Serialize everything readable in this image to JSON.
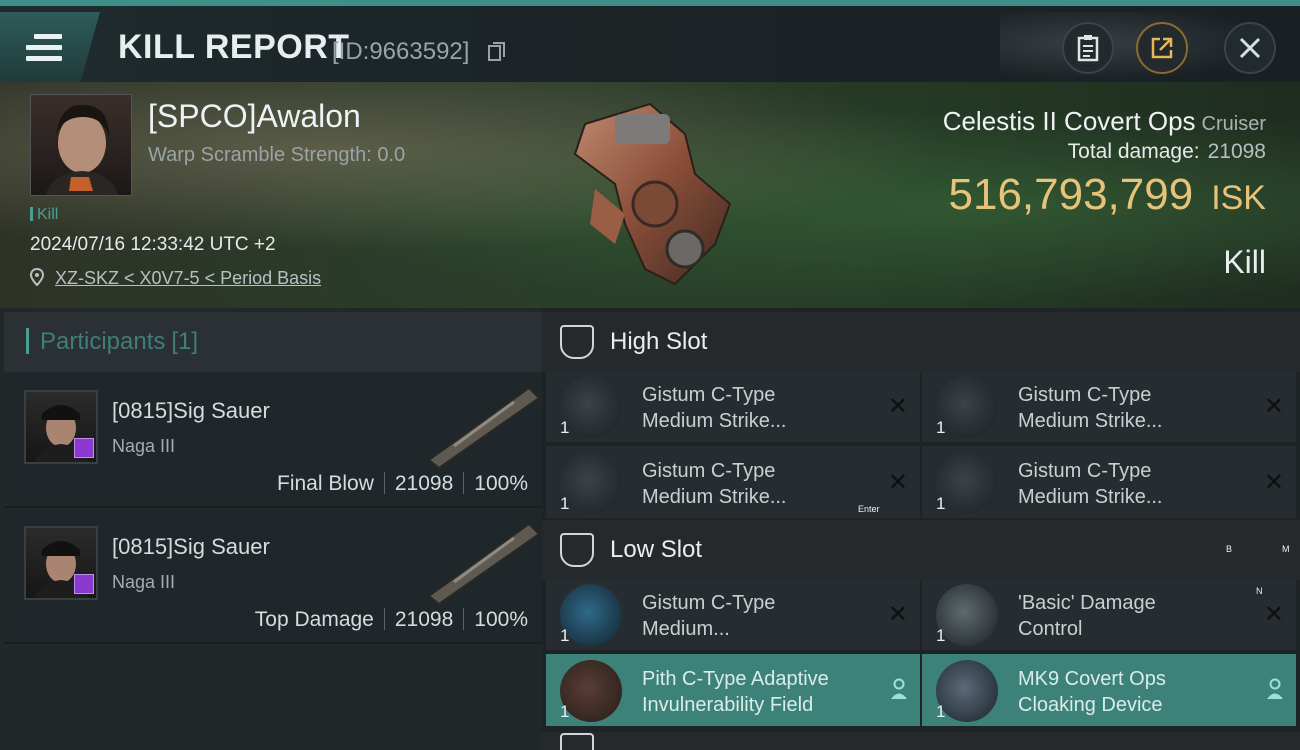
{
  "header": {
    "title": "KILL REPORT",
    "report_id": "[ID:9663592]"
  },
  "victim": {
    "name": "[SPCO]Awalon",
    "warp_scramble": "Warp Scramble Strength: 0.0",
    "kill_tag": "Kill",
    "datetime": "2024/07/16 12:33:42 UTC +2",
    "location": "XZ-SKZ < X0V7-5 < Period Basis"
  },
  "ship": {
    "name": "Celestis II Covert Ops",
    "class": "Cruiser",
    "total_damage_label": "Total damage:",
    "total_damage_value": "21098",
    "isk_value": "516,793,799",
    "isk_unit": "ISK",
    "result": "Kill"
  },
  "participants": {
    "title": "Participants",
    "count": "[1]",
    "rows": [
      {
        "name": "[0815]Sig Sauer",
        "ship": "Naga III",
        "role": "Final Blow",
        "damage": "21098",
        "percent": "100%"
      },
      {
        "name": "[0815]Sig Sauer",
        "ship": "Naga III",
        "role": "Top Damage",
        "damage": "21098",
        "percent": "100%"
      }
    ]
  },
  "slots": {
    "high": {
      "title": "High Slot",
      "items": [
        {
          "line1": "Gistum C-Type",
          "line2": "Medium Strike...",
          "qty": "1"
        },
        {
          "line1": "Gistum C-Type",
          "line2": "Medium Strike...",
          "qty": "1"
        },
        {
          "line1": "Gistum C-Type",
          "line2": "Medium Strike...",
          "qty": "1"
        },
        {
          "line1": "Gistum C-Type",
          "line2": "Medium Strike...",
          "qty": "1"
        }
      ]
    },
    "low": {
      "title": "Low Slot",
      "items": [
        {
          "line1": "Gistum C-Type",
          "line2": "Medium...",
          "qty": "1"
        },
        {
          "line1": "'Basic' Damage",
          "line2": "Control",
          "qty": "1"
        },
        {
          "line1": "Pith C-Type Adaptive",
          "line2": "Invulnerability Field",
          "qty": "1"
        },
        {
          "line1": "MK9 Covert Ops",
          "line2": "Cloaking Device",
          "qty": "1"
        }
      ]
    }
  },
  "overlay_keys": {
    "enter": "Enter",
    "b": "B",
    "m": "M",
    "n": "N"
  },
  "icons": {
    "menu": "hamburger-icon",
    "copy": "copy-icon",
    "clipboard": "clipboard-icon",
    "share": "share-icon",
    "close": "close-icon",
    "location": "location-pin-icon",
    "slot": "slot-shield-icon",
    "dropped": "person-icon",
    "destroyed": "x-icon"
  },
  "colors": {
    "accent": "#4c9e94",
    "isk": "#e7c27a",
    "dropped_bg": "#3d8279"
  }
}
